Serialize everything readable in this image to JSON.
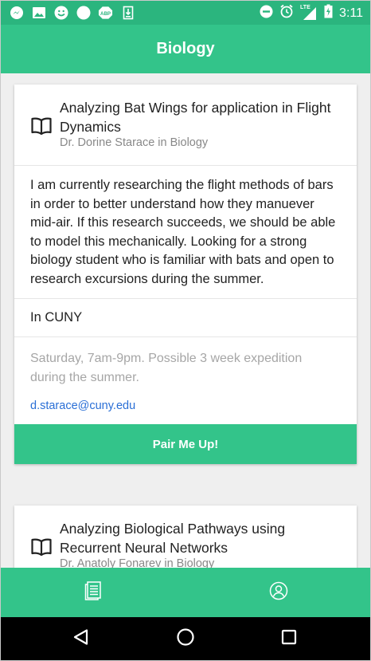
{
  "status_bar": {
    "time": "3:11",
    "network_label": "LTE",
    "icons": [
      "messenger-icon",
      "image-icon",
      "smiley-icon",
      "circle-icon",
      "abp-icon",
      "download-icon",
      "dnd-icon",
      "alarm-icon",
      "signal-icon",
      "battery-icon"
    ],
    "abp_label": "ABP"
  },
  "app_bar": {
    "title": "Biology"
  },
  "cards": [
    {
      "title": "Analyzing Bat Wings for application in Flight Dynamics",
      "subtitle": "Dr. Dorine Starace in Biology",
      "icon": "book-icon",
      "description": "I am currently researching the flight methods of bars in order to better understand how they manuever mid-air. If this research succeeds, we should be able to model this mechanically. Looking for a strong biology student who is familiar with bats and open to research excursions during the summer.",
      "location": "In CUNY",
      "schedule": "Saturday, 7am-9pm. Possible 3 week expedition during the summer.",
      "email": "d.starace@cuny.edu",
      "button_label": "Pair Me Up!"
    },
    {
      "title": "Analyzing Biological Pathways using Recurrent Neural Networks",
      "subtitle": "Dr. Anatoly Fonarev in Biology",
      "icon": "book-icon"
    }
  ],
  "bottom_tabs": [
    {
      "name": "list",
      "icon": "document-list-icon"
    },
    {
      "name": "profile",
      "icon": "profile-icon"
    }
  ],
  "nav_bar": {
    "buttons": [
      "back-icon",
      "home-icon",
      "recents-icon"
    ]
  },
  "colors": {
    "status_bar": "#2bb57e",
    "primary": "#33c48a",
    "link": "#2a6fd6",
    "muted_text": "#a6a6a6",
    "subtitle_text": "#888888",
    "background": "#efefef"
  }
}
